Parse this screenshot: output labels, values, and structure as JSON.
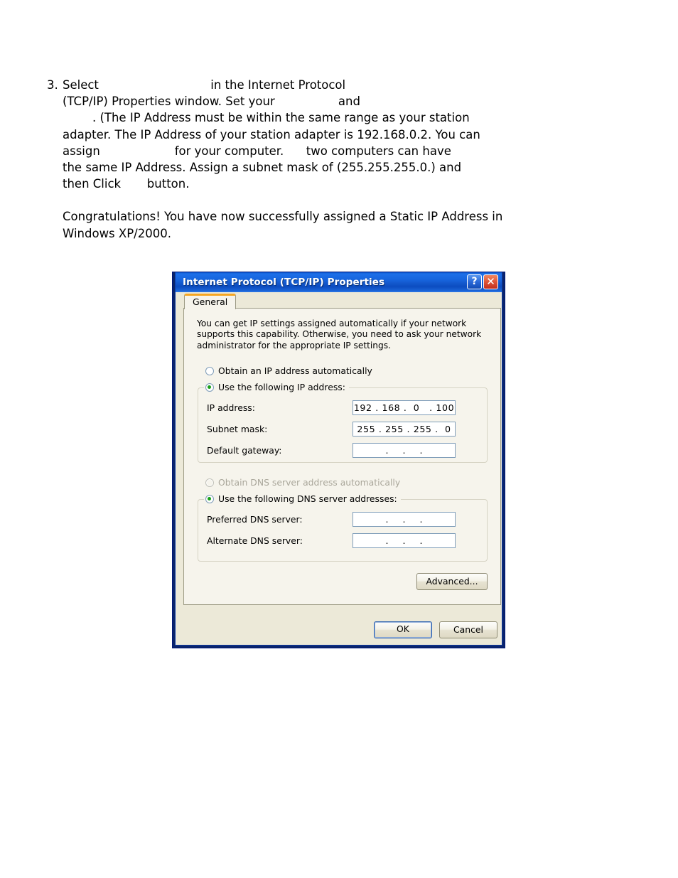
{
  "document": {
    "step": {
      "number": "3.",
      "lines": [
        "Select                              in the Internet Protocol",
        "(TCP/IP) Properties window. Set your                 and",
        "        . (The IP Address must be within the same range as your station",
        "adapter. The IP Address of your station adapter is 192.168.0.2. You can",
        "assign                    for your computer.      two computers can have",
        "the same IP Address. Assign a subnet mask of (255.255.255.0.) and",
        "then Click       button."
      ]
    },
    "closing": "Congratulations! You have now successfully assigned a Static IP Address in\nWindows XP/2000."
  },
  "dialog": {
    "title": "Internet Protocol (TCP/IP) Properties",
    "titlebar_buttons": {
      "help": "?",
      "close": "✕"
    },
    "tabs": [
      {
        "label": "General",
        "active": true
      }
    ],
    "description": "You can get IP settings assigned automatically if your network supports this capability. Otherwise, you need to ask your network administrator for the appropriate IP settings.",
    "ip_section": {
      "auto_option": "Obtain an IP address automatically",
      "manual_option": "Use the following IP address:",
      "selected": "manual",
      "fields": [
        {
          "label": "IP address:",
          "value": "192 . 168 .  0   . 100"
        },
        {
          "label": "Subnet mask:",
          "value": "255 . 255 . 255 .  0"
        },
        {
          "label": "Default gateway:",
          "value": " .     .     . "
        }
      ]
    },
    "dns_section": {
      "auto_option": "Obtain DNS server address automatically",
      "auto_option_disabled": true,
      "manual_option": "Use the following DNS server addresses:",
      "selected": "manual",
      "fields": [
        {
          "label": "Preferred DNS server:",
          "value": " .     .     . "
        },
        {
          "label": "Alternate DNS server:",
          "value": " .     .     . "
        }
      ]
    },
    "buttons": {
      "advanced": "Advanced...",
      "ok": "OK",
      "cancel": "Cancel"
    },
    "colors": {
      "titlebar_blue": "#1764dd",
      "frame_blue": "#0a246a",
      "dialog_face": "#ece9d8",
      "panel_face": "#f6f4ec",
      "tab_accent_orange": "#f5a623",
      "radio_dot_green": "#19a019",
      "close_button_red": "#e0583a",
      "input_border": "#7f9db9"
    }
  }
}
